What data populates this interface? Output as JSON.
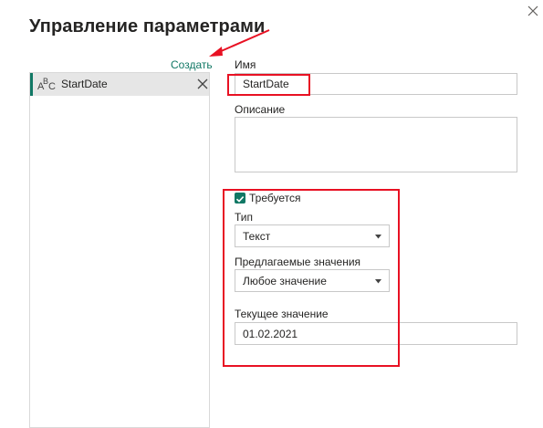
{
  "dialog": {
    "title": "Управление параметрами",
    "close_icon": "close-icon"
  },
  "sidebar": {
    "create_label": "Создать",
    "items": [
      {
        "label": "StartDate",
        "type_icon": "abc-text-type-icon",
        "remove_icon": "close-icon"
      }
    ],
    "abc_glyph": {
      "a": "A",
      "b": "B",
      "c": "C"
    }
  },
  "form": {
    "name_label": "Имя",
    "name_value": "StartDate",
    "description_label": "Описание",
    "description_value": "",
    "required_label": "Требуется",
    "required_checked": true,
    "type_label": "Тип",
    "type_value": "Текст",
    "suggested_label": "Предлагаемые значения",
    "suggested_value": "Любое значение",
    "current_label": "Текущее значение",
    "current_value": "01.02.2021"
  },
  "colors": {
    "accent": "#117865",
    "annotation_red": "#e81123",
    "selected_bg": "#e6e6e6",
    "border": "#c8c8c8"
  }
}
